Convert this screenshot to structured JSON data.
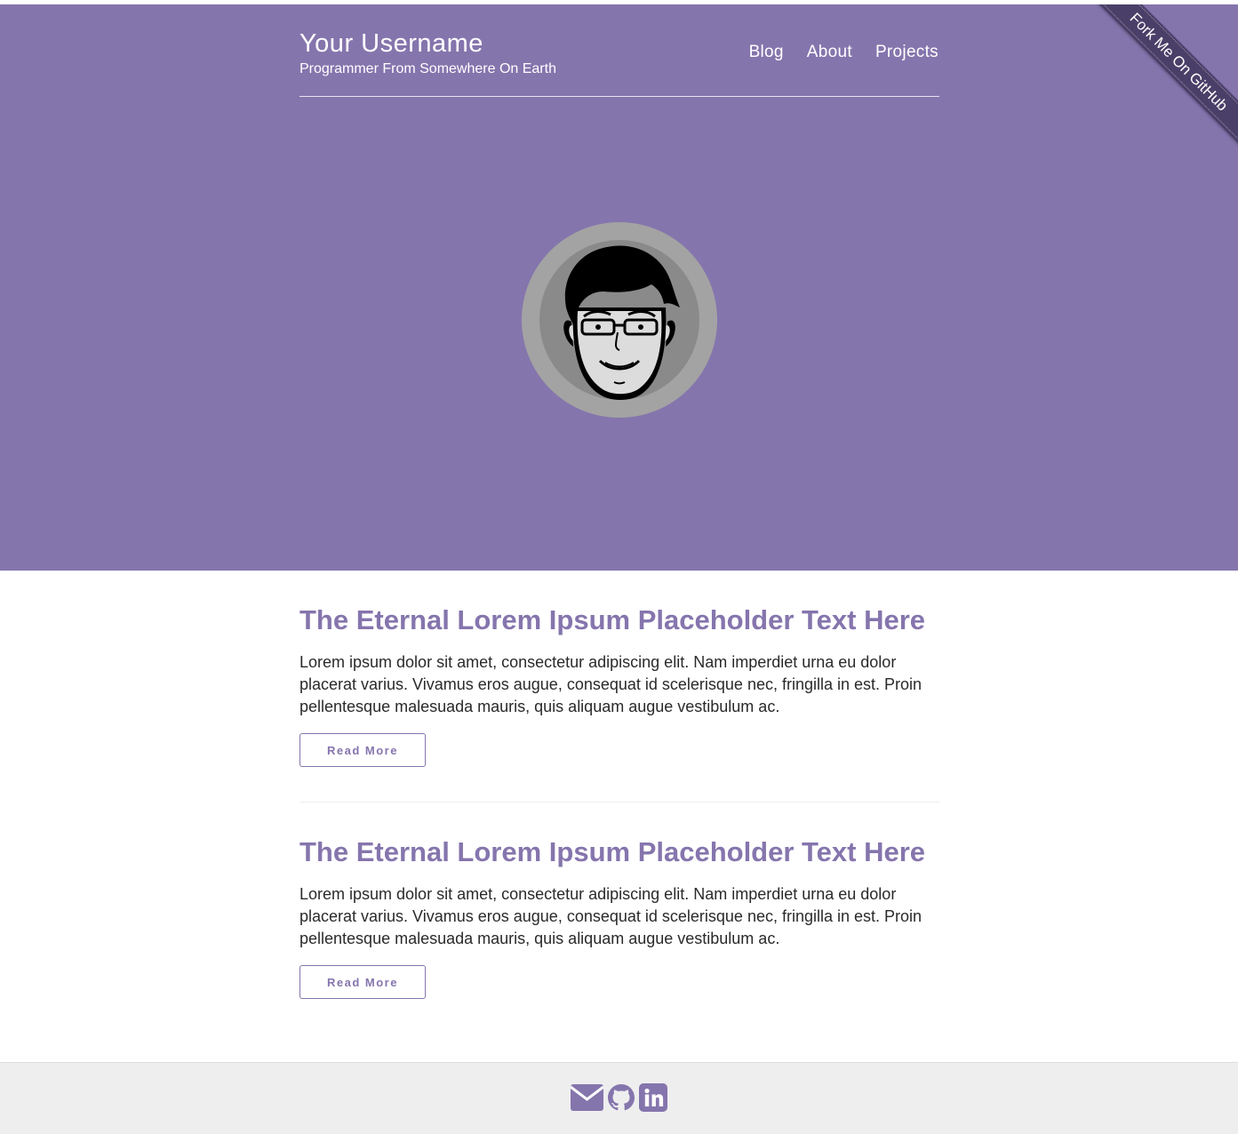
{
  "header": {
    "site_title": "Your Username",
    "tagline": "Programmer From Somewhere On Earth",
    "nav": [
      {
        "label": "Blog"
      },
      {
        "label": "About"
      },
      {
        "label": "Projects"
      }
    ],
    "ribbon_label": "Fork Me On GitHub"
  },
  "posts": [
    {
      "title": "The Eternal Lorem Ipsum Placeholder Text Here",
      "excerpt": "Lorem ipsum dolor sit amet, consectetur adipiscing elit. Nam imperdiet urna eu dolor placerat varius. Vivamus eros augue, consequat id scelerisque nec, fringilla in est. Proin pellentesque malesuada mauris, quis aliquam augue vestibulum ac.",
      "button_label": "Read More"
    },
    {
      "title": "The Eternal Lorem Ipsum Placeholder Text Here",
      "excerpt": "Lorem ipsum dolor sit amet, consectetur adipiscing elit. Nam imperdiet urna eu dolor placerat varius. Vivamus eros augue, consequat id scelerisque nec, fringilla in est. Proin pellentesque malesuada mauris, quis aliquam augue vestibulum ac.",
      "button_label": "Read More"
    }
  ],
  "footer": {
    "icons": [
      "email-icon",
      "github-icon",
      "linkedin-icon"
    ]
  },
  "colors": {
    "accent": "#8575ad",
    "ribbon": "#4a3f68",
    "footer_bg": "#eeeeee",
    "text": "#2a2a2a"
  }
}
